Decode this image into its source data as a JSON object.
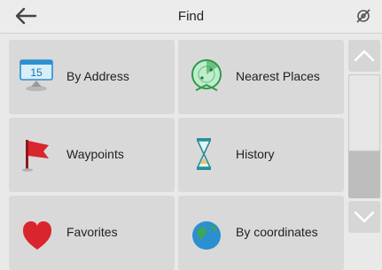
{
  "header": {
    "back_icon": "back-arrow-icon",
    "title": "Find",
    "status_icon": "gps-off-icon"
  },
  "tiles": [
    {
      "label": "By Address",
      "icon": "address-calendar-icon"
    },
    {
      "label": "Nearest Places",
      "icon": "radar-icon"
    },
    {
      "label": "Waypoints",
      "icon": "red-flag-icon"
    },
    {
      "label": "History",
      "icon": "hourglass-icon"
    },
    {
      "label": "Favorites",
      "icon": "heart-icon"
    },
    {
      "label": "By coordinates",
      "icon": "globe-icon"
    }
  ],
  "address_icon_number": "15",
  "scrollbar": {
    "up_icon": "chevron-up-icon",
    "down_icon": "chevron-down-icon"
  },
  "colors": {
    "accent_red": "#d9262e",
    "radar_green": "#2e9b4a",
    "hourglass_teal": "#2a8d9c"
  }
}
